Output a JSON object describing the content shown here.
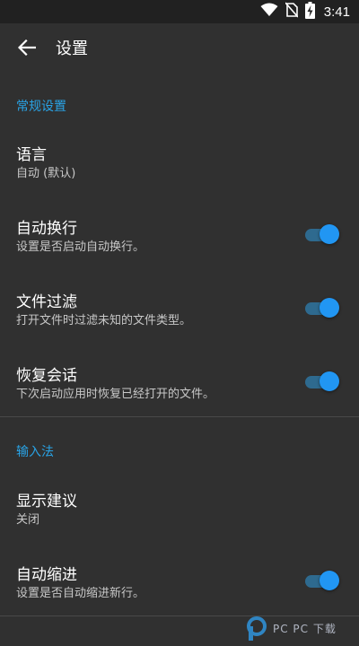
{
  "status_bar": {
    "time": "3:41",
    "icons": [
      "wifi-icon",
      "no-sim-icon",
      "battery-charging-icon"
    ]
  },
  "app_bar": {
    "back_icon": "arrow-left-icon",
    "title": "设置"
  },
  "sections": [
    {
      "header": "常规设置",
      "items": [
        {
          "title": "语言",
          "summary": "自动 (默认)"
        },
        {
          "title": "自动换行",
          "summary": "设置是否启动自动换行。",
          "switch_on": true
        },
        {
          "title": "文件过滤",
          "summary": "打开文件时过滤未知的文件类型。",
          "switch_on": true
        },
        {
          "title": "恢复会话",
          "summary": "下次启动应用时恢复已经打开的文件。",
          "switch_on": true
        }
      ]
    },
    {
      "header": "输入法",
      "items": [
        {
          "title": "显示建议",
          "summary": "关闭"
        },
        {
          "title": "自动缩进",
          "summary": "设置是否自动缩进新行。",
          "switch_on": true
        }
      ]
    }
  ],
  "colors": {
    "accent": "#29a3e6",
    "switch_thumb": "#2196f3",
    "background": "#303030"
  },
  "watermark": {
    "text": "PC PC 下载"
  }
}
